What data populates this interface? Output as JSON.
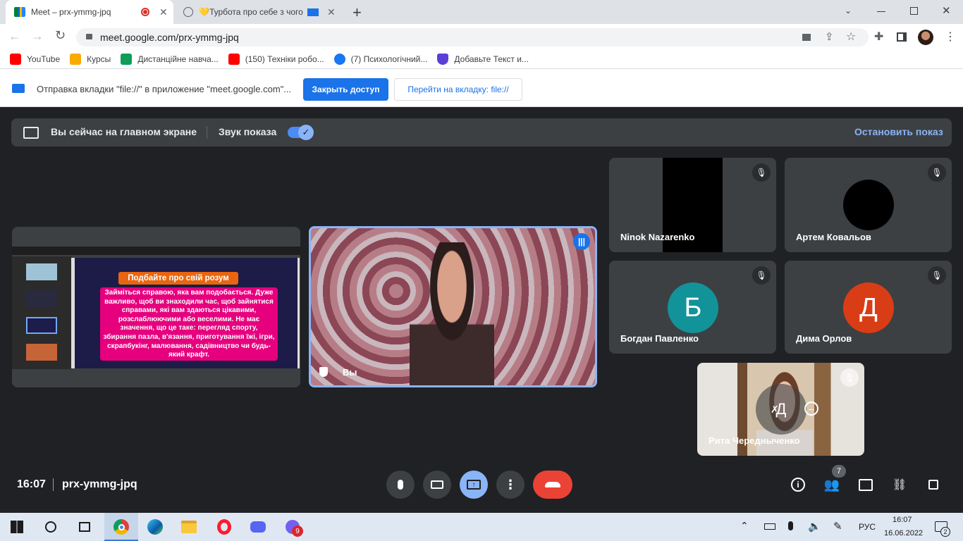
{
  "browser": {
    "tabs": [
      {
        "title": "Meet – prx-ymmg-jpq",
        "active": true
      },
      {
        "title": "💛Турбота про себе з чого",
        "active": false
      }
    ],
    "url": "meet.google.com/prx-ymmg-jpq",
    "bookmarks": [
      "YouTube",
      "Курсы",
      "Дистанційне навча...",
      "(150) Техніки робо...",
      "(7) Психологічний...",
      "Добавьте Текст и..."
    ],
    "infobar": {
      "text": "Отправка вкладки \"file://\" в приложение \"meet.google.com\"...",
      "stop_button": "Закрыть доступ",
      "switch_button": "Перейти на вкладку: file://"
    }
  },
  "meet": {
    "present_bar": {
      "label": "Вы сейчас на главном экране",
      "audio_label": "Звук показа",
      "audio_on": true,
      "stop_label": "Остановить показ"
    },
    "slide": {
      "title": "Подбайте про свій розум",
      "body": "Займіться справою, яка вам подобається. Дуже важливо, щоб ви знаходили час, щоб зайнятися справами, які вам здаються цікавими, розслаблюючими або веселими. Не має значення, що це таке: перегляд спорту, збирання пазла, в'язання, приготування їжі, ігри, скрапбукінг, малювання, садівництво чи будь-який крафт."
    },
    "self_name": "Вы",
    "participants": [
      {
        "name": "Ninok Nazarenko",
        "initial": "",
        "color": "#000000"
      },
      {
        "name": "Артем Ковальов",
        "initial": "",
        "color": "#000000"
      },
      {
        "name": "Богдан Павленко",
        "initial": "Б",
        "color": "#12939a"
      },
      {
        "name": "Дима Орлов",
        "initial": "Д",
        "color": "#d93d15"
      },
      {
        "name": "Рита Чередныченко",
        "initial": "Д",
        "color": "#c0c0c0"
      }
    ],
    "time": "16:07",
    "meeting_code": "prx-ymmg-jpq",
    "people_count": "7"
  },
  "taskbar": {
    "lang": "РУС",
    "time": "16:07",
    "date": "16.06.2022",
    "viber_badge": "9",
    "notif_count": "2"
  }
}
